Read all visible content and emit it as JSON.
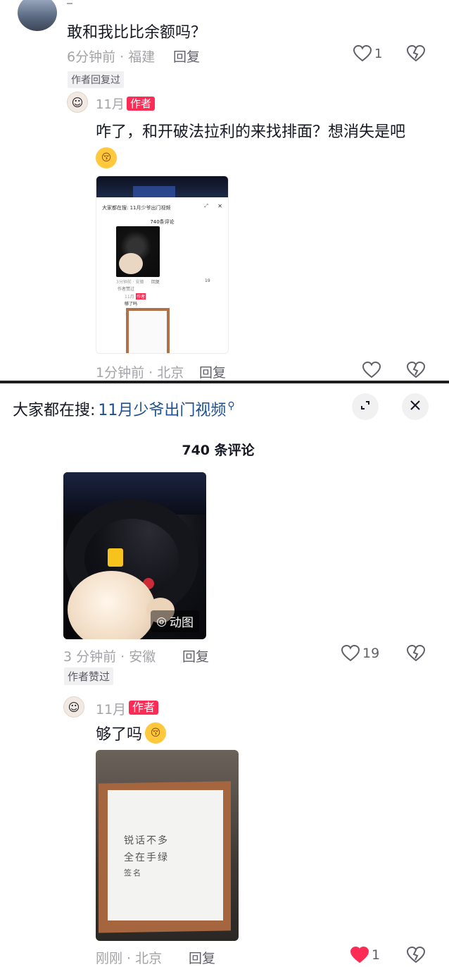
{
  "top_comment": {
    "text": "敢和我比比余额吗？",
    "time_location": "6分钟前 · 福建",
    "reply_label": "回复",
    "like_count": "1",
    "badge": "作者回复过",
    "author_reply": {
      "username": "11月",
      "author_tag": "作者",
      "text": "咋了，和开破法拉利的来找排面？想消失是吧",
      "emoji": "smirk-kiss-emoji",
      "time_location": "1分钟前 · 北京",
      "reply_label": "回复",
      "embedded_screenshot": {
        "search": "大家都在搜: 11月少爷出门视频",
        "count": "740条评论",
        "meta": "3分钟前 · 安徽",
        "reply": "回复",
        "likes": "19",
        "badge": "作者赞过",
        "username": "11月",
        "author_tag": "作者",
        "text": "够了吗"
      }
    }
  },
  "panel": {
    "search_prefix": "大家都在搜:",
    "search_query": "11月少爷出门视频",
    "comment_count": "740 条评论",
    "expand_icon": "expand-icon",
    "close_icon": "close-icon"
  },
  "comment": {
    "image_label": "动图",
    "time_location": "3 分钟前 · 安徽",
    "reply_label": "回复",
    "like_count": "19",
    "badge": "作者赞过",
    "author_reply": {
      "username": "11月",
      "author_tag": "作者",
      "text": "够了吗",
      "emoji": "smirk-kiss-emoji",
      "time_location": "刚刚 · 北京",
      "reply_label": "回复",
      "like_count": "1",
      "liked": true,
      "handwriting": [
        "锐话不多",
        "全在手绿",
        "    签名"
      ]
    }
  },
  "colors": {
    "accent": "#fe2c55",
    "meta": "#a3a3a8",
    "search_query": "#1d4f91"
  }
}
